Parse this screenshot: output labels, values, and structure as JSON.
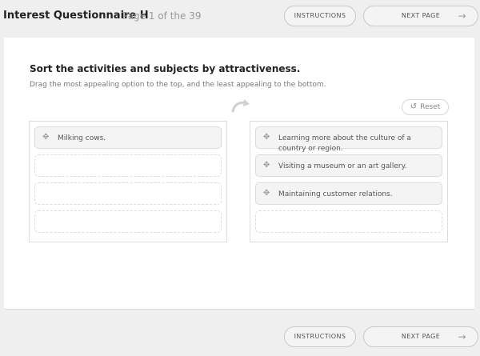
{
  "header": {
    "title": "Interest Questionnaire H",
    "page_info": "Page 1 of the 39",
    "instructions_label": "INSTRUCTIONS",
    "next_label": "NEXT PAGE",
    "next_icon": "arrow-right-icon"
  },
  "question": {
    "title": "Sort the activities and subjects by attractiveness.",
    "instruction": "Drag the most appealing option to the top, and the least appealing to the bottom."
  },
  "reset": {
    "label": "Reset",
    "icon": "undo-icon"
  },
  "left_items": [
    {
      "label": "Milking cows."
    }
  ],
  "right_items": [
    {
      "label": "Learning more about the culture of a country or region."
    },
    {
      "label": "Visiting a museum or an art gallery."
    },
    {
      "label": "Maintaining customer relations."
    }
  ],
  "footer": {
    "instructions_label": "INSTRUCTIONS",
    "next_label": "NEXT PAGE"
  },
  "colors": {
    "background": "#efefef",
    "card": "#ffffff",
    "item": "#f4f4f4",
    "border": "#dcdcdc"
  }
}
